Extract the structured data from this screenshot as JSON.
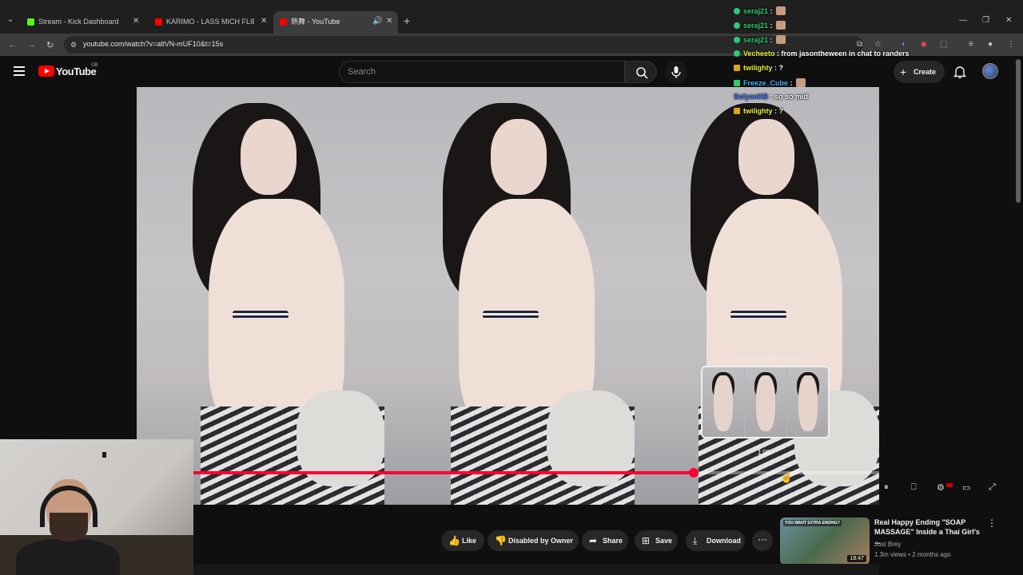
{
  "browser": {
    "tabs": [
      {
        "label": "Stream - Kick Dashboard",
        "color": "#53fc18"
      },
      {
        "label": "KARIMO - LASS MICH FLIEGEN",
        "color": "#ff0000"
      },
      {
        "label": "熱舞 - YouTube",
        "color": "#ff0000"
      }
    ],
    "url": "youtube.com/watch?v=altVN-mUF10&t=15s"
  },
  "youtube": {
    "logo_text": "YouTube",
    "region": "GB",
    "search_placeholder": "Search",
    "create_label": "Create"
  },
  "video": {
    "seek_hint": "Pull up for precise seeking",
    "preview_time": "1:00",
    "progress": 0.73
  },
  "chat": [
    {
      "user": "seraj21",
      "color": "#2ecc71",
      "text": "",
      "emote": true
    },
    {
      "user": "seraj21",
      "color": "#2ecc71",
      "text": "",
      "emote": true
    },
    {
      "user": "seraj21",
      "color": "#2ecc71",
      "text": "",
      "emote": true
    },
    {
      "user": "Vecheeto",
      "color": "#e8f24a",
      "text": "from jasontheween in chat to randers",
      "emote": false
    },
    {
      "user": "twilighty",
      "color": "#e8f24a",
      "text": "?",
      "emote": false
    },
    {
      "user": "Freeze_Cube",
      "color": "#4ab2f2",
      "text": "",
      "emote": true
    },
    {
      "user": "SofyenKB",
      "color": "#4a7ef2",
      "text": "so so mid",
      "emote": false
    },
    {
      "user": "twilighty",
      "color": "#e8f24a",
      "text": "?",
      "emote": false
    }
  ],
  "actions": {
    "like": "Like",
    "dislike": "Disabled by Owner",
    "share": "Share",
    "save": "Save",
    "download": "Download"
  },
  "related": {
    "thumb_caption": "YOU WANT EXTRA ENDING?",
    "duration": "18:47",
    "title": "Real Happy Ending \"SOAP MASSAGE\" Inside a Thai Girl's ...",
    "channel": "Just Brey",
    "meta": "1.3m views • 2 months ago"
  },
  "colors": {
    "accent": "#ff0033",
    "background": "#0f0f0f"
  }
}
